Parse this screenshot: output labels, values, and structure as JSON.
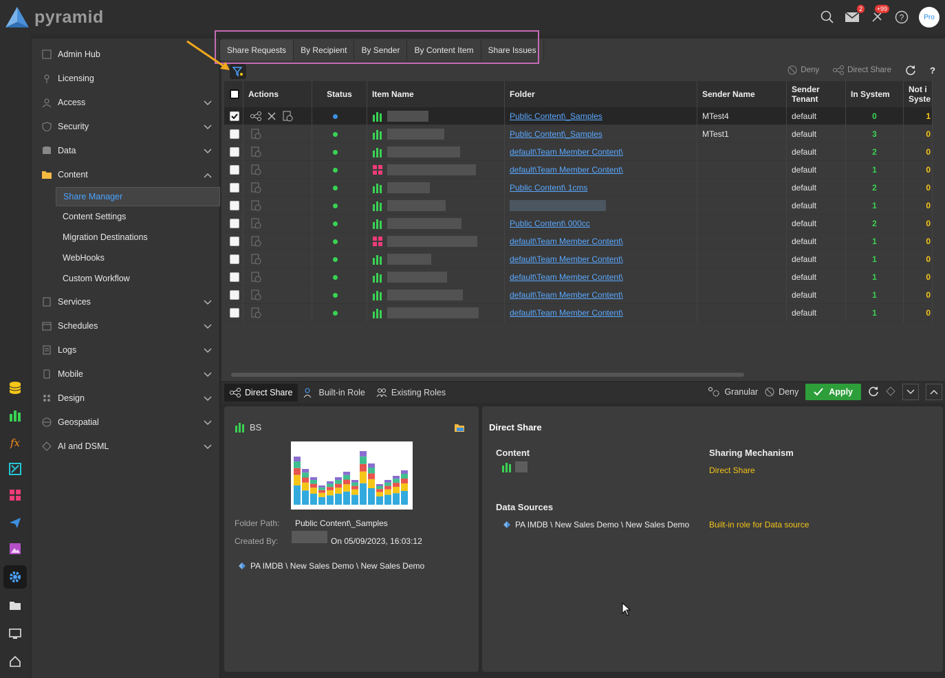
{
  "app": {
    "logo_text": "pyramid",
    "avatar_label": "Pro",
    "notif_badge_mail": "2",
    "notif_badge_alerts": "+99"
  },
  "sidebar": {
    "items": [
      {
        "label": "Admin Hub"
      },
      {
        "label": "Licensing"
      },
      {
        "label": "Access"
      },
      {
        "label": "Security"
      },
      {
        "label": "Data"
      },
      {
        "label": "Content"
      },
      {
        "label": "Services"
      },
      {
        "label": "Schedules"
      },
      {
        "label": "Logs"
      },
      {
        "label": "Mobile"
      },
      {
        "label": "Design"
      },
      {
        "label": "Geospatial"
      },
      {
        "label": "AI and DSML"
      }
    ],
    "content_sub": [
      {
        "label": "Share Manager"
      },
      {
        "label": "Content Settings"
      },
      {
        "label": "Migration Destinations"
      },
      {
        "label": "WebHooks"
      },
      {
        "label": "Custom Workflow"
      }
    ]
  },
  "tabs": [
    "Share Requests",
    "By Recipient",
    "By Sender",
    "By Content Item",
    "Share Issues"
  ],
  "toolbar": {
    "deny": "Deny",
    "direct_share": "Direct Share",
    "help": "?"
  },
  "grid": {
    "headers": {
      "actions": "Actions",
      "status": "Status",
      "item_name": "Item Name",
      "folder": "Folder",
      "sender_name": "Sender Name",
      "sender_tenant_1": "Sender",
      "sender_tenant_2": "Tenant",
      "in_system": "In System",
      "not_in_1": "Not i",
      "not_in_2": "Syste"
    },
    "rows": [
      {
        "folder": "Public Content\\_Samples",
        "sender": "MTest4",
        "tenant": "default",
        "in_system": "0",
        "not_in": "1",
        "status": "blue",
        "type": "bar"
      },
      {
        "folder": "Public Content\\_Samples",
        "sender": "MTest1",
        "tenant": "default",
        "in_system": "3",
        "not_in": "0",
        "status": "green",
        "type": "bar"
      },
      {
        "folder": "default\\Team Member Content\\",
        "sender": "",
        "tenant": "default",
        "in_system": "2",
        "not_in": "0",
        "status": "green",
        "type": "bar"
      },
      {
        "folder": "default\\Team Member Content\\",
        "sender": "",
        "tenant": "default",
        "in_system": "1",
        "not_in": "0",
        "status": "green",
        "type": "grid"
      },
      {
        "folder": "Public Content\\            1cms",
        "sender": "",
        "tenant": "default",
        "in_system": "2",
        "not_in": "0",
        "status": "green",
        "type": "bar"
      },
      {
        "folder": "",
        "sender": "",
        "tenant": "default",
        "in_system": "1",
        "not_in": "0",
        "status": "green",
        "type": "bar"
      },
      {
        "folder": "Public Content\\    000cc",
        "sender": "",
        "tenant": "default",
        "in_system": "2",
        "not_in": "0",
        "status": "green",
        "type": "bar"
      },
      {
        "folder": "default\\Team Member Content\\",
        "sender": "",
        "tenant": "default",
        "in_system": "1",
        "not_in": "0",
        "status": "green",
        "type": "grid"
      },
      {
        "folder": "default\\Team Member Content\\",
        "sender": "",
        "tenant": "default",
        "in_system": "1",
        "not_in": "0",
        "status": "green",
        "type": "bar"
      },
      {
        "folder": "default\\Team Member Content\\",
        "sender": "",
        "tenant": "default",
        "in_system": "1",
        "not_in": "0",
        "status": "green",
        "type": "bar"
      },
      {
        "folder": "default\\Team Member Content\\",
        "sender": "",
        "tenant": "default",
        "in_system": "1",
        "not_in": "0",
        "status": "green",
        "type": "bar"
      },
      {
        "folder": "default\\Team Member Content\\",
        "sender": "",
        "tenant": "default",
        "in_system": "1",
        "not_in": "0",
        "status": "green",
        "type": "bar"
      }
    ]
  },
  "bottom_bar": {
    "direct_share": "Direct Share",
    "builtin_role": "Built-in Role",
    "existing_roles": "Existing Roles",
    "granular": "Granular",
    "deny": "Deny",
    "apply": "Apply"
  },
  "details": {
    "item_title": "BS",
    "folder_path_label": "Folder Path:",
    "folder_path_value": "Public Content\\_Samples",
    "created_by_label": "Created By:",
    "created_on": "On 05/09/2023, 16:03:12",
    "data_source": "PA IMDB \\ New Sales Demo \\ New Sales Demo"
  },
  "share_panel": {
    "title": "Direct Share",
    "content_label": "Content",
    "mechanism_label": "Sharing Mechanism",
    "mechanism_value": "Direct Share",
    "data_sources_label": "Data Sources",
    "data_source_value": "PA IMDB \\ New Sales Demo \\ New Sales Demo",
    "data_source_mechanism": "Built-in role for Data source"
  },
  "colors": {
    "accent": "#4aa3ff",
    "green": "#39d353",
    "yellow": "#f5c518",
    "pink_box": "#c56bb5"
  }
}
